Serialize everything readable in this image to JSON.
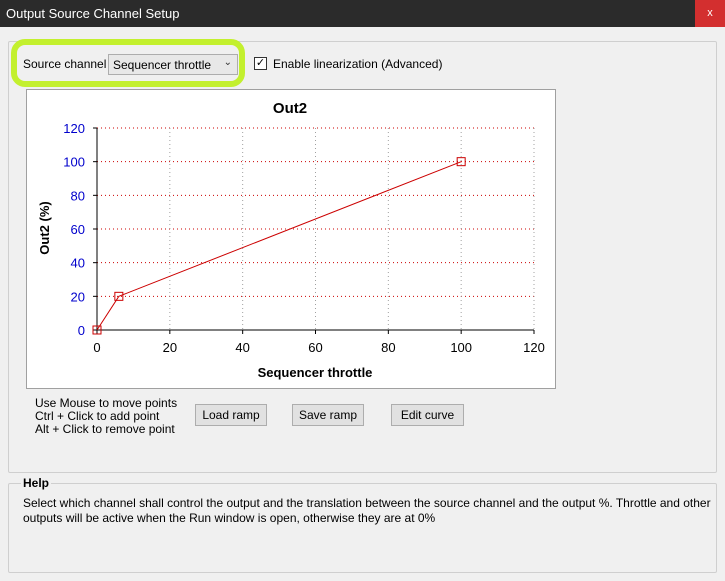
{
  "window": {
    "title": "Output Source Channel Setup",
    "close_label": "x"
  },
  "source": {
    "label": "Source channel",
    "selected": "Sequencer throttle",
    "linearization_label": "Enable linearization (Advanced)",
    "linearization_checked": true
  },
  "hints": [
    "Use Mouse to move points",
    "Ctrl + Click to add point",
    "Alt + Click to remove point"
  ],
  "buttons": {
    "load": "Load ramp",
    "save": "Save ramp",
    "edit": "Edit curve"
  },
  "help": {
    "title": "Help",
    "text": "Select which channel shall control the output and the translation between the source channel and the output %. Throttle and other outputs will be active when the Run window is open, otherwise they are at 0%"
  },
  "chart_data": {
    "type": "line",
    "title": "Out2",
    "xlabel": "Sequencer throttle",
    "ylabel": "Out2 (%)",
    "xlim": [
      0,
      120
    ],
    "ylim": [
      0,
      120
    ],
    "xticks": [
      "0",
      "20",
      "40",
      "60",
      "80",
      "100",
      "120"
    ],
    "yticks": [
      "0",
      "20",
      "40",
      "60",
      "80",
      "100",
      "120"
    ],
    "grid": true,
    "colors": {
      "line": "#cc0000",
      "ytick": "#0000cc",
      "grid": "#cc0000"
    },
    "points": [
      {
        "x": 0,
        "y": 0
      },
      {
        "x": 6,
        "y": 20
      },
      {
        "x": 100,
        "y": 100
      }
    ]
  }
}
